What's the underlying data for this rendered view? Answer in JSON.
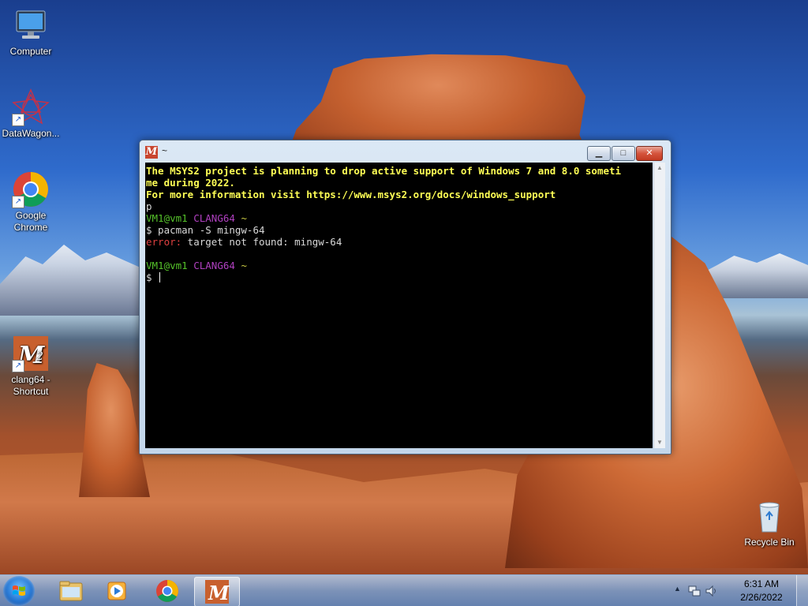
{
  "desktop": {
    "icons": [
      {
        "label": "Computer",
        "icon": "computer-icon"
      },
      {
        "label": "DataWagon...",
        "icon": "datawagon-icon"
      },
      {
        "label": "Google Chrome",
        "icon": "chrome-icon"
      },
      {
        "label": "clang64 - Shortcut",
        "icon": "msys2-clang64-icon"
      },
      {
        "label": "Recycle Bin",
        "icon": "recycle-bin-icon"
      }
    ]
  },
  "terminal": {
    "title": "~",
    "app_icon": "msys2-icon",
    "lines": [
      {
        "segments": [
          {
            "text": "The MSYS2 project is planning to drop active support of Windows 7 and 8.0 someti",
            "color": "#ffff55",
            "bold": true
          }
        ]
      },
      {
        "segments": [
          {
            "text": "me during 2022.",
            "color": "#ffff55",
            "bold": true
          }
        ]
      },
      {
        "segments": [
          {
            "text": "For more information visit https://www.msys2.org/docs/windows_support",
            "color": "#ffff55",
            "bold": true
          }
        ]
      },
      {
        "segments": [
          {
            "text": "p",
            "color": "#d9d9d9",
            "bold": false
          }
        ]
      },
      {
        "segments": [
          {
            "text": "VM1@vm1 ",
            "color": "#55c22a",
            "bold": false
          },
          {
            "text": "CLANG64 ",
            "color": "#b040c0",
            "bold": false
          },
          {
            "text": "~",
            "color": "#cccc44",
            "bold": false
          }
        ]
      },
      {
        "segments": [
          {
            "text": "$ pacman -S mingw-64",
            "color": "#d9d9d9",
            "bold": false
          }
        ]
      },
      {
        "segments": [
          {
            "text": "error:",
            "color": "#e04040",
            "bold": false
          },
          {
            "text": " target not found: mingw-64",
            "color": "#d9d9d9",
            "bold": false
          }
        ]
      },
      {
        "segments": [
          {
            "text": "",
            "color": "#d9d9d9",
            "bold": false
          }
        ]
      },
      {
        "segments": [
          {
            "text": "VM1@vm1 ",
            "color": "#55c22a",
            "bold": false
          },
          {
            "text": "CLANG64 ",
            "color": "#b040c0",
            "bold": false
          },
          {
            "text": "~",
            "color": "#cccc44",
            "bold": false
          }
        ]
      },
      {
        "segments": [
          {
            "text": "$ ",
            "color": "#d9d9d9",
            "bold": false
          }
        ],
        "cursor": true
      }
    ],
    "buttons": {
      "minimize": "minimize-icon",
      "maximize": "maximize-icon",
      "close": "close-icon"
    }
  },
  "taskbar": {
    "start": "windows-start-icon",
    "pinned": [
      {
        "name": "file-explorer",
        "icon": "folder-icon",
        "active": false
      },
      {
        "name": "media-player",
        "icon": "media-player-icon",
        "active": false
      },
      {
        "name": "google-chrome",
        "icon": "chrome-icon",
        "active": false
      },
      {
        "name": "msys2-terminal",
        "icon": "msys2-icon",
        "active": true
      }
    ],
    "tray": {
      "time": "6:31 AM",
      "date": "2/26/2022",
      "icons": [
        "show-hidden-icons-arrow",
        "network-icon",
        "volume-icon"
      ]
    }
  },
  "colors": {
    "terminal_background": "#000000",
    "warning_text": "#ffff55",
    "prompt_user": "#55c22a",
    "prompt_env": "#b040c0",
    "error": "#e04040"
  }
}
